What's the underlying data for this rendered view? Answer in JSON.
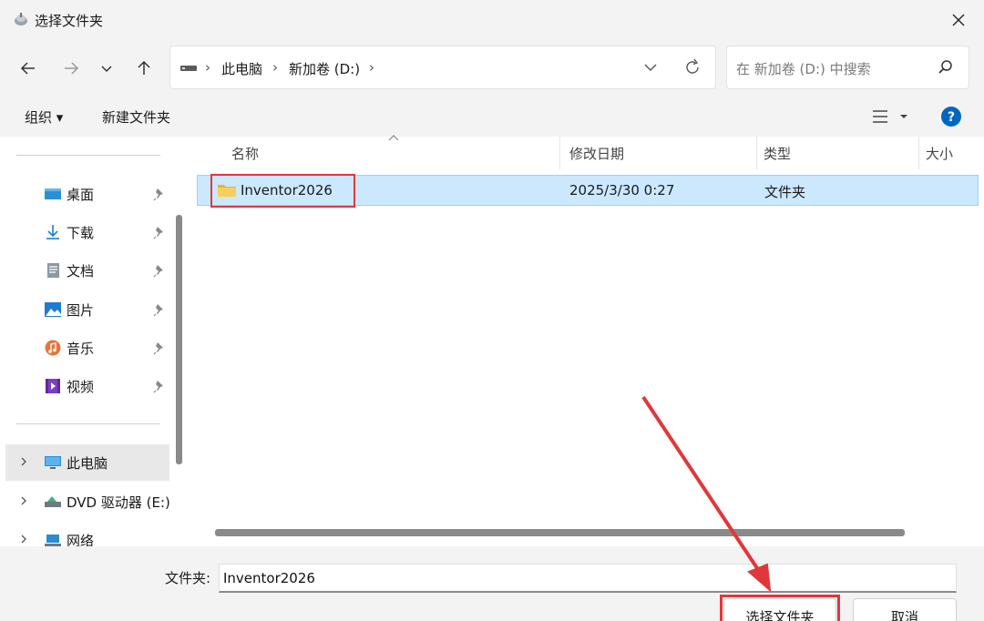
{
  "window": {
    "title": "选择文件夹"
  },
  "address": {
    "segments": [
      "此电脑",
      "新加卷 (D:)"
    ]
  },
  "search": {
    "placeholder": "在 新加卷 (D:) 中搜索"
  },
  "toolbar": {
    "organize": "组织 ▾",
    "new_folder": "新建文件夹"
  },
  "sidebar": {
    "quick_access": [
      {
        "label": "桌面",
        "icon": "desktop-icon"
      },
      {
        "label": "下载",
        "icon": "download-icon"
      },
      {
        "label": "文档",
        "icon": "document-icon"
      },
      {
        "label": "图片",
        "icon": "picture-icon"
      },
      {
        "label": "音乐",
        "icon": "music-icon"
      },
      {
        "label": "视频",
        "icon": "video-icon"
      }
    ],
    "locations": [
      {
        "label": "此电脑",
        "icon": "computer-icon"
      },
      {
        "label": "DVD 驱动器 (E:)",
        "icon": "dvd-icon"
      },
      {
        "label": "网络",
        "icon": "network-icon"
      }
    ]
  },
  "columns": {
    "name": "名称",
    "modified": "修改日期",
    "type": "类型",
    "size": "大小"
  },
  "files": [
    {
      "name": "Inventor2026",
      "modified": "2025/3/30 0:27",
      "type": "文件夹"
    }
  ],
  "footer": {
    "folder_label": "文件夹:",
    "folder_value": "Inventor2026",
    "select_button": "选择文件夹",
    "cancel_button": "取消"
  },
  "colors": {
    "selection": "#cce8ff",
    "annotation": "#e0383a",
    "accent": "#0067c0"
  }
}
